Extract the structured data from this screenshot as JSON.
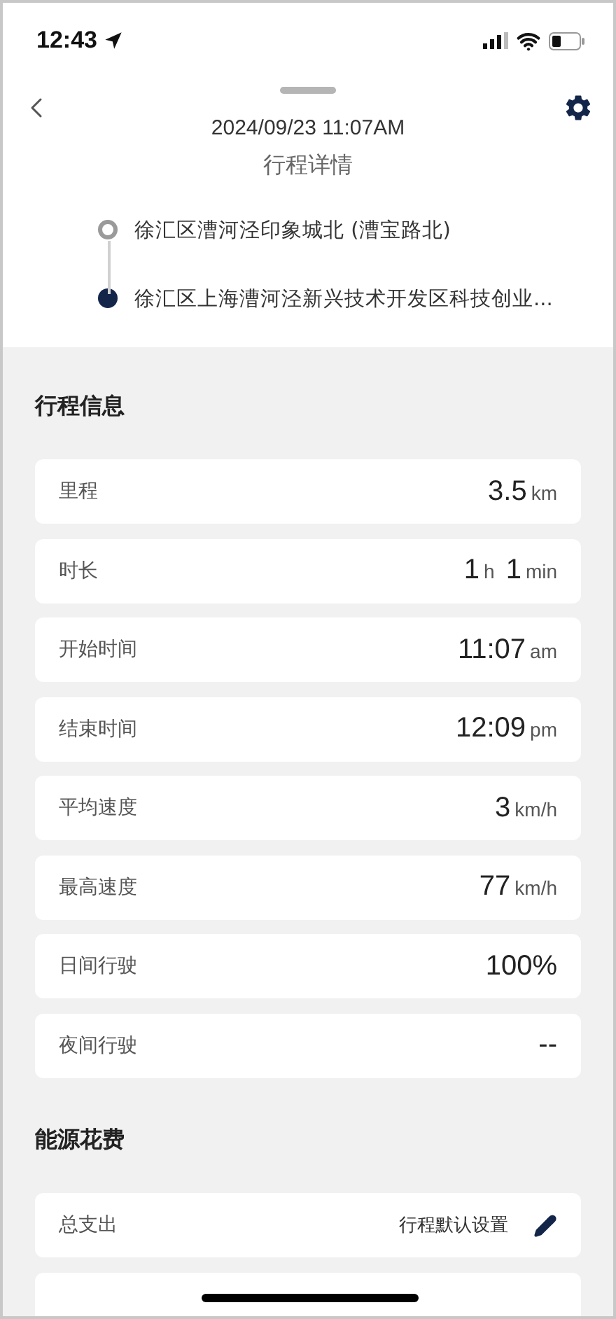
{
  "status_bar": {
    "time": "12:43"
  },
  "header": {
    "datetime": "2024/09/23 11:07AM",
    "title": "行程详情"
  },
  "route": [
    {
      "kind": "start",
      "address": "徐汇区漕河泾印象城北 (漕宝路北)"
    },
    {
      "kind": "end",
      "address": "徐汇区上海漕河泾新兴技术开发区科技创业..."
    }
  ],
  "trip_info": {
    "title": "行程信息",
    "rows": [
      {
        "label": "里程",
        "parts": [
          {
            "kind": "number",
            "text": "3.5"
          },
          {
            "kind": "unit",
            "text": "km"
          }
        ]
      },
      {
        "label": "时长",
        "parts": [
          {
            "kind": "number",
            "text": "1"
          },
          {
            "kind": "unit",
            "text": "h"
          },
          {
            "kind": "number",
            "text": "1"
          },
          {
            "kind": "unit",
            "text": "min"
          }
        ]
      },
      {
        "label": "开始时间",
        "parts": [
          {
            "kind": "number",
            "text": "11:07"
          },
          {
            "kind": "unit",
            "text": "am"
          }
        ]
      },
      {
        "label": "结束时间",
        "parts": [
          {
            "kind": "number",
            "text": "12:09"
          },
          {
            "kind": "unit",
            "text": "pm"
          }
        ]
      },
      {
        "label": "平均速度",
        "parts": [
          {
            "kind": "number",
            "text": "3"
          },
          {
            "kind": "unit",
            "text": "km/h"
          }
        ]
      },
      {
        "label": "最高速度",
        "parts": [
          {
            "kind": "number",
            "text": "77"
          },
          {
            "kind": "unit",
            "text": "km/h"
          }
        ]
      },
      {
        "label": "日间行驶",
        "parts": [
          {
            "kind": "number",
            "text": "100%"
          }
        ]
      },
      {
        "label": "夜间行驶",
        "parts": [
          {
            "kind": "number",
            "text": "--"
          }
        ]
      }
    ]
  },
  "energy_cost": {
    "title": "能源花费",
    "rows": [
      {
        "label": "总支出",
        "link": "行程默认设置"
      }
    ]
  }
}
